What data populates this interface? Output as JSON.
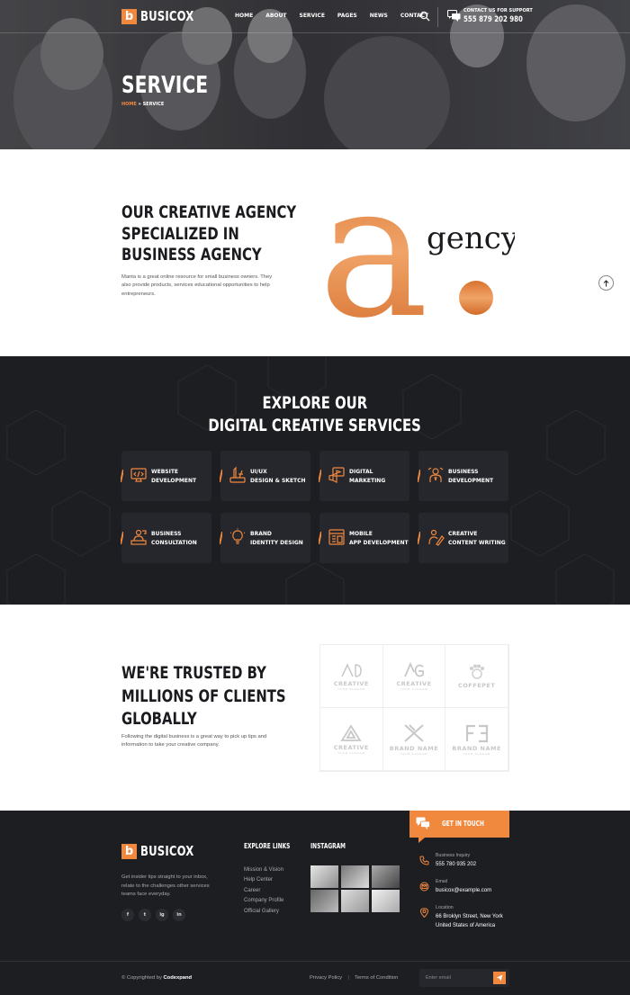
{
  "brand": {
    "name": "BUSICOX",
    "letter": "b",
    "accent": "#f0883e"
  },
  "nav": {
    "items": [
      "HOME",
      "ABOUT",
      "SERVICE",
      "PAGES",
      "NEWS",
      "CONTACT"
    ]
  },
  "support": {
    "label": "CONTACT US FOR SUPPORT",
    "phone": "555 879 202 980"
  },
  "hero": {
    "title": "SERVICE",
    "breadcrumb": {
      "home": "HOME",
      "sep": "»",
      "current": "SERVICE"
    }
  },
  "agency": {
    "heading": [
      "OUR CREATIVE AGENCY",
      "SPECIALIZED IN",
      "BUSINESS AGENCY"
    ],
    "text": "Manta is a great online resource for small business owners. They also provide products, services educational opportunities to help entrepreneurs.",
    "art_letter": "a",
    "art_word": "gency"
  },
  "services": {
    "title": [
      "EXPLORE OUR",
      "DIGITAL CREATIVE SERVICES"
    ],
    "items": [
      {
        "line1": "WEBSITE",
        "line2": "DEVELOPMENT",
        "icon": "code-monitor-icon"
      },
      {
        "line1": "UI/UX",
        "line2": "DESIGN & SKETCH",
        "icon": "design-tools-icon"
      },
      {
        "line1": "DIGITAL",
        "line2": "MARKETING",
        "icon": "megaphone-icon"
      },
      {
        "line1": "BUSINESS",
        "line2": "DEVELOPMENT",
        "icon": "businessman-icon"
      },
      {
        "line1": "BUSINESS",
        "line2": "CONSULTATION",
        "icon": "consultant-icon"
      },
      {
        "line1": "BRAND",
        "line2": "IDENTITY DESIGN",
        "icon": "lightbulb-icon"
      },
      {
        "line1": "MOBILE",
        "line2": "APP DEVELOPMENT",
        "icon": "mobile-app-icon"
      },
      {
        "line1": "CREATIVE",
        "line2": "CONTENT WRITING",
        "icon": "pen-writing-icon"
      }
    ]
  },
  "trust": {
    "heading": [
      "WE'RE TRUSTED BY",
      "MILLIONS OF CLIENTS",
      "GLOBALLY"
    ],
    "text": "Following the digital business is a great way to pick up tips and information to take your creative company.",
    "logos": [
      {
        "name": "CREATIVE",
        "sub": "YOUR SLOGAN"
      },
      {
        "name": "CREATIVE",
        "sub": "YOUR SLOGAN"
      },
      {
        "name": "COFFEPET",
        "sub": ""
      },
      {
        "name": "CREATIVE",
        "sub": "YOUR SLOGAN"
      },
      {
        "name": "BRAND NAME",
        "sub": "YOUR SLOGAN"
      },
      {
        "name": "BRAND NAME",
        "sub": "YOUR SLOGAN"
      }
    ]
  },
  "footer": {
    "about": "Get insider tips straight to your inbox, relate to the challenges other services teams face everyday.",
    "socials": [
      "f",
      "t",
      "ig",
      "in"
    ],
    "links_title": "EXPLORE LINKS",
    "links": [
      "Mission & Vision",
      "Help Center",
      "Career",
      "Company Profile",
      "Official Gallery"
    ],
    "instagram_title": "INSTAGRAM",
    "touch_title": "GET IN TOUCH",
    "contact": {
      "inquiry_label": "Business Inquiry",
      "inquiry_value": "555 780 935 202",
      "email_label": "Email",
      "email_value": "busicox@example.com",
      "location_label": "Location",
      "location_line1": "66 Broklyn Street, New York",
      "location_line2": "United States of America"
    },
    "copyright_prefix": "© Copyrighted by",
    "copyright_name": "Codexpand",
    "privacy": "Privacy Policy",
    "terms": "Terms of Condition",
    "link_sep": "|",
    "email_placeholder": "Enter email"
  }
}
